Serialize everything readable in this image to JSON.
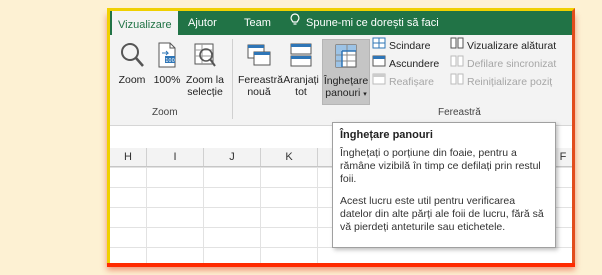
{
  "tabs": [
    {
      "label": "Vizualizare",
      "active": true
    },
    {
      "label": "Ajutor"
    },
    {
      "label": "Team"
    },
    {
      "label": "Spune-mi ce dorești să faci"
    }
  ],
  "ribbon": {
    "zoom_group": {
      "zoom": "Zoom",
      "hundred": "100%",
      "zoom_sel_line1": "Zoom la",
      "zoom_sel_line2": "selecție",
      "group_label": "Zoom"
    },
    "window_group": {
      "new_window_line1": "Fereastră",
      "new_window_line2": "nouă",
      "arrange_line1": "Aranjați",
      "arrange_line2": "tot",
      "freeze_line1": "Înghețare",
      "freeze_line2": "panouri",
      "split": "Scindare",
      "hide": "Ascundere",
      "unhide": "Reafișare",
      "side_by_side": "Vizualizare alăturat",
      "sync_scroll": "Defilare sincronizat",
      "reset_pos": "Reinițializare poziț",
      "group_label": "Fereastră"
    }
  },
  "columns": [
    "H",
    "I",
    "J",
    "K",
    "F"
  ],
  "tooltip": {
    "title": "Înghețare panouri",
    "p1": "Înghețați o porțiune din foaie, pentru a rămâne vizibilă în timp ce defilați prin restul foii.",
    "p2": "Acest lucru este util pentru verificarea datelor din alte părți ale foii de lucru, fără să vă pierdeți anteturile sau etichetele."
  },
  "colors": {
    "excel_green": "#217346",
    "background": "#fdf1d3"
  }
}
